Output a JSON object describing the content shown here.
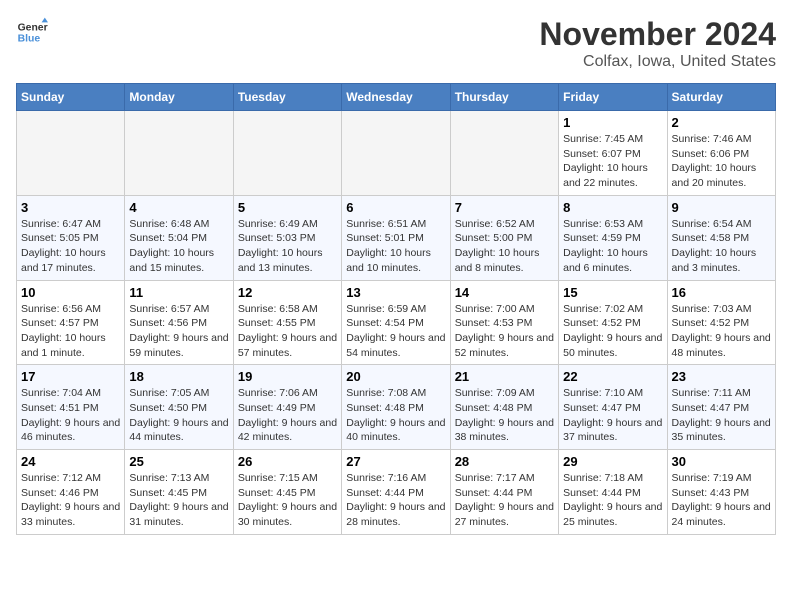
{
  "header": {
    "logo_line1": "General",
    "logo_line2": "Blue",
    "month": "November 2024",
    "location": "Colfax, Iowa, United States"
  },
  "weekdays": [
    "Sunday",
    "Monday",
    "Tuesday",
    "Wednesday",
    "Thursday",
    "Friday",
    "Saturday"
  ],
  "weeks": [
    [
      {
        "day": "",
        "empty": true
      },
      {
        "day": "",
        "empty": true
      },
      {
        "day": "",
        "empty": true
      },
      {
        "day": "",
        "empty": true
      },
      {
        "day": "",
        "empty": true
      },
      {
        "day": "1",
        "sunrise": "Sunrise: 7:45 AM",
        "sunset": "Sunset: 6:07 PM",
        "daylight": "Daylight: 10 hours and 22 minutes."
      },
      {
        "day": "2",
        "sunrise": "Sunrise: 7:46 AM",
        "sunset": "Sunset: 6:06 PM",
        "daylight": "Daylight: 10 hours and 20 minutes."
      }
    ],
    [
      {
        "day": "3",
        "sunrise": "Sunrise: 6:47 AM",
        "sunset": "Sunset: 5:05 PM",
        "daylight": "Daylight: 10 hours and 17 minutes."
      },
      {
        "day": "4",
        "sunrise": "Sunrise: 6:48 AM",
        "sunset": "Sunset: 5:04 PM",
        "daylight": "Daylight: 10 hours and 15 minutes."
      },
      {
        "day": "5",
        "sunrise": "Sunrise: 6:49 AM",
        "sunset": "Sunset: 5:03 PM",
        "daylight": "Daylight: 10 hours and 13 minutes."
      },
      {
        "day": "6",
        "sunrise": "Sunrise: 6:51 AM",
        "sunset": "Sunset: 5:01 PM",
        "daylight": "Daylight: 10 hours and 10 minutes."
      },
      {
        "day": "7",
        "sunrise": "Sunrise: 6:52 AM",
        "sunset": "Sunset: 5:00 PM",
        "daylight": "Daylight: 10 hours and 8 minutes."
      },
      {
        "day": "8",
        "sunrise": "Sunrise: 6:53 AM",
        "sunset": "Sunset: 4:59 PM",
        "daylight": "Daylight: 10 hours and 6 minutes."
      },
      {
        "day": "9",
        "sunrise": "Sunrise: 6:54 AM",
        "sunset": "Sunset: 4:58 PM",
        "daylight": "Daylight: 10 hours and 3 minutes."
      }
    ],
    [
      {
        "day": "10",
        "sunrise": "Sunrise: 6:56 AM",
        "sunset": "Sunset: 4:57 PM",
        "daylight": "Daylight: 10 hours and 1 minute."
      },
      {
        "day": "11",
        "sunrise": "Sunrise: 6:57 AM",
        "sunset": "Sunset: 4:56 PM",
        "daylight": "Daylight: 9 hours and 59 minutes."
      },
      {
        "day": "12",
        "sunrise": "Sunrise: 6:58 AM",
        "sunset": "Sunset: 4:55 PM",
        "daylight": "Daylight: 9 hours and 57 minutes."
      },
      {
        "day": "13",
        "sunrise": "Sunrise: 6:59 AM",
        "sunset": "Sunset: 4:54 PM",
        "daylight": "Daylight: 9 hours and 54 minutes."
      },
      {
        "day": "14",
        "sunrise": "Sunrise: 7:00 AM",
        "sunset": "Sunset: 4:53 PM",
        "daylight": "Daylight: 9 hours and 52 minutes."
      },
      {
        "day": "15",
        "sunrise": "Sunrise: 7:02 AM",
        "sunset": "Sunset: 4:52 PM",
        "daylight": "Daylight: 9 hours and 50 minutes."
      },
      {
        "day": "16",
        "sunrise": "Sunrise: 7:03 AM",
        "sunset": "Sunset: 4:52 PM",
        "daylight": "Daylight: 9 hours and 48 minutes."
      }
    ],
    [
      {
        "day": "17",
        "sunrise": "Sunrise: 7:04 AM",
        "sunset": "Sunset: 4:51 PM",
        "daylight": "Daylight: 9 hours and 46 minutes."
      },
      {
        "day": "18",
        "sunrise": "Sunrise: 7:05 AM",
        "sunset": "Sunset: 4:50 PM",
        "daylight": "Daylight: 9 hours and 44 minutes."
      },
      {
        "day": "19",
        "sunrise": "Sunrise: 7:06 AM",
        "sunset": "Sunset: 4:49 PM",
        "daylight": "Daylight: 9 hours and 42 minutes."
      },
      {
        "day": "20",
        "sunrise": "Sunrise: 7:08 AM",
        "sunset": "Sunset: 4:48 PM",
        "daylight": "Daylight: 9 hours and 40 minutes."
      },
      {
        "day": "21",
        "sunrise": "Sunrise: 7:09 AM",
        "sunset": "Sunset: 4:48 PM",
        "daylight": "Daylight: 9 hours and 38 minutes."
      },
      {
        "day": "22",
        "sunrise": "Sunrise: 7:10 AM",
        "sunset": "Sunset: 4:47 PM",
        "daylight": "Daylight: 9 hours and 37 minutes."
      },
      {
        "day": "23",
        "sunrise": "Sunrise: 7:11 AM",
        "sunset": "Sunset: 4:47 PM",
        "daylight": "Daylight: 9 hours and 35 minutes."
      }
    ],
    [
      {
        "day": "24",
        "sunrise": "Sunrise: 7:12 AM",
        "sunset": "Sunset: 4:46 PM",
        "daylight": "Daylight: 9 hours and 33 minutes."
      },
      {
        "day": "25",
        "sunrise": "Sunrise: 7:13 AM",
        "sunset": "Sunset: 4:45 PM",
        "daylight": "Daylight: 9 hours and 31 minutes."
      },
      {
        "day": "26",
        "sunrise": "Sunrise: 7:15 AM",
        "sunset": "Sunset: 4:45 PM",
        "daylight": "Daylight: 9 hours and 30 minutes."
      },
      {
        "day": "27",
        "sunrise": "Sunrise: 7:16 AM",
        "sunset": "Sunset: 4:44 PM",
        "daylight": "Daylight: 9 hours and 28 minutes."
      },
      {
        "day": "28",
        "sunrise": "Sunrise: 7:17 AM",
        "sunset": "Sunset: 4:44 PM",
        "daylight": "Daylight: 9 hours and 27 minutes."
      },
      {
        "day": "29",
        "sunrise": "Sunrise: 7:18 AM",
        "sunset": "Sunset: 4:44 PM",
        "daylight": "Daylight: 9 hours and 25 minutes."
      },
      {
        "day": "30",
        "sunrise": "Sunrise: 7:19 AM",
        "sunset": "Sunset: 4:43 PM",
        "daylight": "Daylight: 9 hours and 24 minutes."
      }
    ]
  ]
}
